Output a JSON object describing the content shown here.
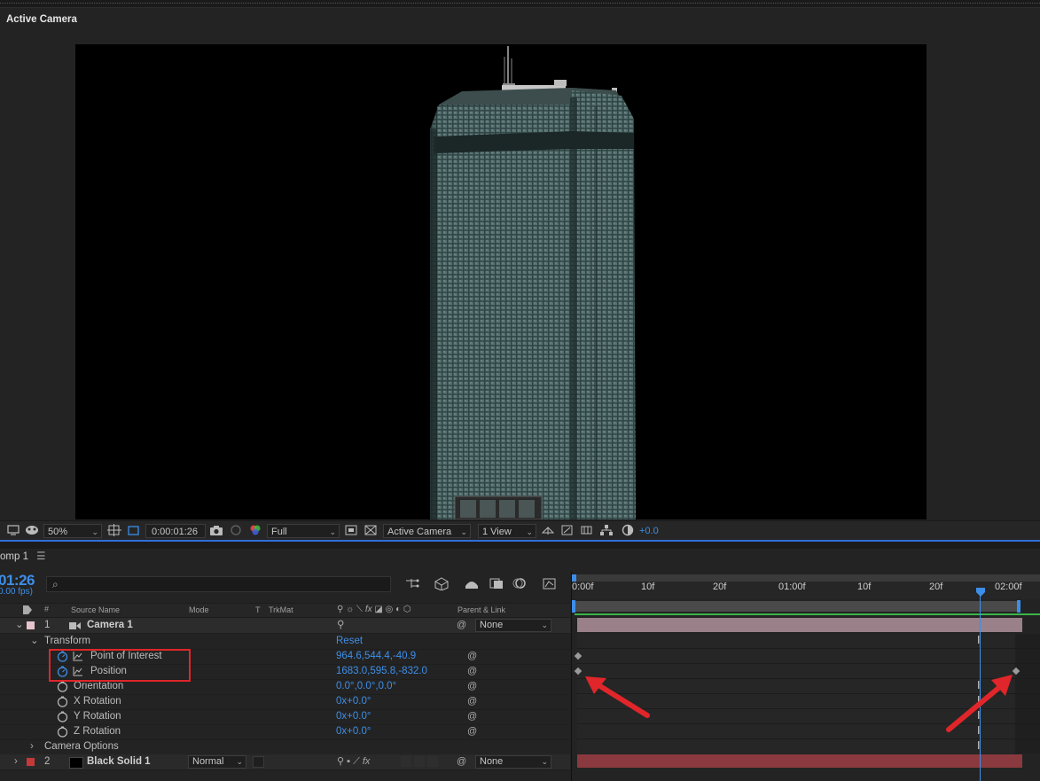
{
  "viewer": {
    "title": "Active Camera"
  },
  "viewer_toolbar": {
    "zoom": "50%",
    "timecode": "0:00:01:26",
    "resolution": "Full",
    "camera": "Active Camera",
    "views": "1 View",
    "exposure": "+0.0"
  },
  "timeline": {
    "tab_label": "omp 1",
    "current_time": "01:26",
    "fps": "0.00 fps)",
    "columns": {
      "source_name": "Source Name",
      "mode": "Mode",
      "t": "T",
      "trkmat": "TrkMat",
      "parent": "Parent & Link"
    },
    "ruler_ticks": [
      "0:00f",
      "10f",
      "20f",
      "01:00f",
      "10f",
      "20f",
      "02:00f"
    ],
    "layers": [
      {
        "number": "1",
        "name": "Camera 1",
        "parent": "None",
        "color": "#e8c3cc"
      },
      {
        "number": "2",
        "name": "Black Solid 1",
        "mode": "Normal",
        "parent": "None",
        "color": "#c43a3a"
      }
    ],
    "transform": {
      "group_label": "Transform",
      "reset_label": "Reset",
      "properties": [
        {
          "name": "Point of Interest",
          "value": "964.6,544.4,-40.9"
        },
        {
          "name": "Position",
          "value": "1683.0,595.8,-832.0"
        },
        {
          "name": "Orientation",
          "value": "0.0°,0.0°,0.0°"
        },
        {
          "name": "X Rotation",
          "value": "0x+0.0°"
        },
        {
          "name": "Y Rotation",
          "value": "0x+0.0°"
        },
        {
          "name": "Z Rotation",
          "value": "0x+0.0°"
        }
      ]
    },
    "camera_options_label": "Camera Options"
  },
  "colors": {
    "accent_blue": "#3d8ee8",
    "highlight_red": "#e0262a",
    "camera_track": "#9a8088",
    "solid_track": "#8a3a3e"
  }
}
